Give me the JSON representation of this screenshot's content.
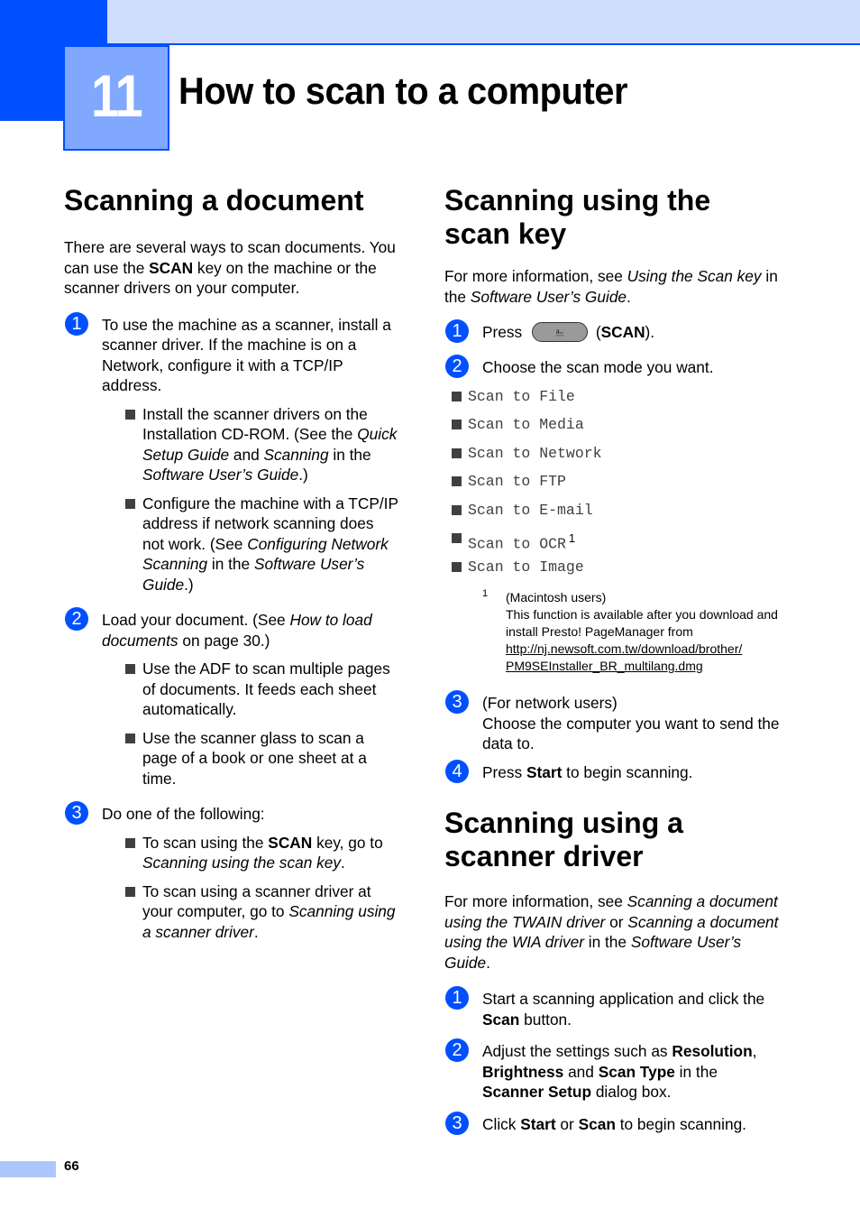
{
  "header": {
    "chapter_number": "11",
    "chapter_title": "How to scan to a computer",
    "colors": {
      "accent_blue": "#0050ff",
      "light_band": "#cfddfc",
      "chapter_box": "#80a8ff"
    }
  },
  "left": {
    "title": "Scanning a document",
    "intro": [
      {
        "t": "There are several ways to scan documents. You can use the "
      },
      {
        "t": "SCAN",
        "b": true
      },
      {
        "t": " key on the machine or the scanner drivers on your computer."
      }
    ],
    "steps": [
      {
        "num": "1",
        "text": [
          {
            "t": "To use the machine as a scanner, install a scanner driver. If the machine is on a Network, configure it with a TCP/IP address."
          }
        ],
        "bullets": [
          [
            {
              "t": "Install the scanner drivers on the Installation CD-ROM. (See the "
            },
            {
              "t": "Quick Setup Guide",
              "i": true
            },
            {
              "t": " and "
            },
            {
              "t": "Scanning",
              "i": true
            },
            {
              "t": " in the "
            },
            {
              "t": "Software User’s Guide",
              "i": true
            },
            {
              "t": ".)"
            }
          ],
          [
            {
              "t": "Configure the machine with a TCP/IP address if network scanning does not work. (See "
            },
            {
              "t": "Configuring Network Scanning",
              "i": true
            },
            {
              "t": " in the "
            },
            {
              "t": "Software User’s Guide",
              "i": true
            },
            {
              "t": ".)"
            }
          ]
        ]
      },
      {
        "num": "2",
        "text": [
          {
            "t": "Load your document. (See "
          },
          {
            "t": "How to load documents",
            "i": true
          },
          {
            "t": " on page 30.)"
          }
        ],
        "bullets": [
          [
            {
              "t": "Use the ADF to scan multiple pages of documents. It feeds each sheet automatically."
            }
          ],
          [
            {
              "t": "Use the scanner glass to scan a page of a book or one sheet at a time."
            }
          ]
        ]
      },
      {
        "num": "3",
        "text": [
          {
            "t": "Do one of the following:"
          }
        ],
        "bullets": [
          [
            {
              "t": "To scan using the "
            },
            {
              "t": "SCAN",
              "b": true
            },
            {
              "t": " key, go to "
            },
            {
              "t": "Scanning using the scan key",
              "i": true
            },
            {
              "t": "."
            }
          ],
          [
            {
              "t": "To scan using a scanner driver at your computer, go to "
            },
            {
              "t": "Scanning using a scanner driver",
              "i": true
            },
            {
              "t": "."
            }
          ]
        ]
      }
    ]
  },
  "right": {
    "scan_key_section": {
      "title": "Scanning using the scan key",
      "intro": [
        {
          "t": "For more information, see "
        },
        {
          "t": "Using the Scan key",
          "i": true
        },
        {
          "t": " in the "
        },
        {
          "t": "Software User’s Guide",
          "i": true
        },
        {
          "t": "."
        }
      ],
      "step1": {
        "num": "1",
        "press": "Press",
        "key_icon": "scanner-key-icon",
        "key_glyph": "⎁",
        "after": "(",
        "key_name": "SCAN",
        "close": ")."
      },
      "step2": {
        "num": "2",
        "text": "Choose the scan mode you want."
      },
      "modes": [
        {
          "label": "Scan to File"
        },
        {
          "label": "Scan to Media"
        },
        {
          "label": "Scan to Network"
        },
        {
          "label": "Scan to FTP"
        },
        {
          "label": "Scan to E-mail"
        },
        {
          "label": "Scan to OCR",
          "footnote": "1"
        },
        {
          "label": "Scan to Image"
        }
      ],
      "footnote": {
        "mark": "1",
        "line1": "(Macintosh users)",
        "line2": "This function is available after you download and install Presto! PageManager from",
        "link": "http://nj.newsoft.com.tw/download/brother/PM9SEInstaller_BR_multilang.dmg",
        "link_line1": "http://nj.newsoft.com.tw/download/brother/",
        "link_line2": "PM9SEInstaller_BR_multilang.dmg"
      },
      "step3": {
        "num": "3",
        "line1": "(For network users)",
        "line2": "Choose the computer you want to send the data to."
      },
      "step4": {
        "num": "4",
        "text": [
          {
            "t": "Press "
          },
          {
            "t": "Start",
            "b": true
          },
          {
            "t": " to begin scanning."
          }
        ]
      }
    },
    "driver_section": {
      "title": "Scanning using a scanner driver",
      "intro": [
        {
          "t": "For more information, see "
        },
        {
          "t": "Scanning a document using the TWAIN driver",
          "i": true
        },
        {
          "t": " or "
        },
        {
          "t": "Scanning a document using the WIA driver",
          "i": true
        },
        {
          "t": " in the "
        },
        {
          "t": "Software User’s Guide",
          "i": true
        },
        {
          "t": "."
        }
      ],
      "steps": [
        {
          "num": "1",
          "text": [
            {
              "t": "Start a scanning application and click the "
            },
            {
              "t": "Scan",
              "b": true
            },
            {
              "t": " button."
            }
          ]
        },
        {
          "num": "2",
          "text": [
            {
              "t": "Adjust the settings such as "
            },
            {
              "t": "Resolution",
              "b": true
            },
            {
              "t": ", "
            },
            {
              "t": "Brightness",
              "b": true
            },
            {
              "t": " and "
            },
            {
              "t": "Scan Type",
              "b": true
            },
            {
              "t": " in the "
            },
            {
              "t": "Scanner Setup",
              "b": true
            },
            {
              "t": " dialog box."
            }
          ]
        },
        {
          "num": "3",
          "text": [
            {
              "t": "Click "
            },
            {
              "t": "Start",
              "b": true
            },
            {
              "t": " or "
            },
            {
              "t": "Scan",
              "b": true
            },
            {
              "t": " to begin scanning."
            }
          ]
        }
      ]
    }
  },
  "footer": {
    "page_number": "66"
  }
}
